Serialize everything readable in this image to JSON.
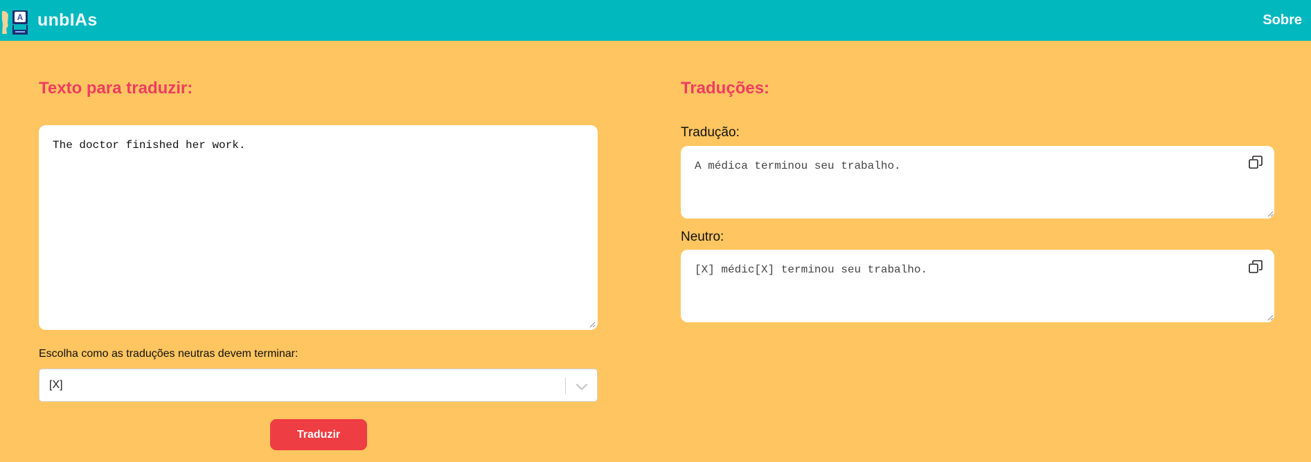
{
  "app": {
    "name": "unbIAs"
  },
  "nav": {
    "about_label": "Sobre"
  },
  "source": {
    "heading": "Texto para traduzir:",
    "text": "The doctor finished her work."
  },
  "ending_selector": {
    "label": "Escolha como as traduções neutras devem terminar:",
    "selected": "[X]"
  },
  "translate_button": {
    "label": "Traduzir"
  },
  "results": {
    "heading": "Traduções:",
    "translation": {
      "label": "Tradução:",
      "text": "A médica terminou seu trabalho."
    },
    "neutral": {
      "label": "Neutro:",
      "text": "[X] médic[X] terminou seu trabalho."
    }
  },
  "colors": {
    "navbar": "#02b8bf",
    "background": "#fec560",
    "heading": "#ee3d62",
    "button": "#ee3d43"
  },
  "icons": {
    "logo": "translator-mascot-logo",
    "copy": "copy-icon",
    "dropdown": "chevron-down-icon",
    "resize": "resize-grip-icon"
  }
}
